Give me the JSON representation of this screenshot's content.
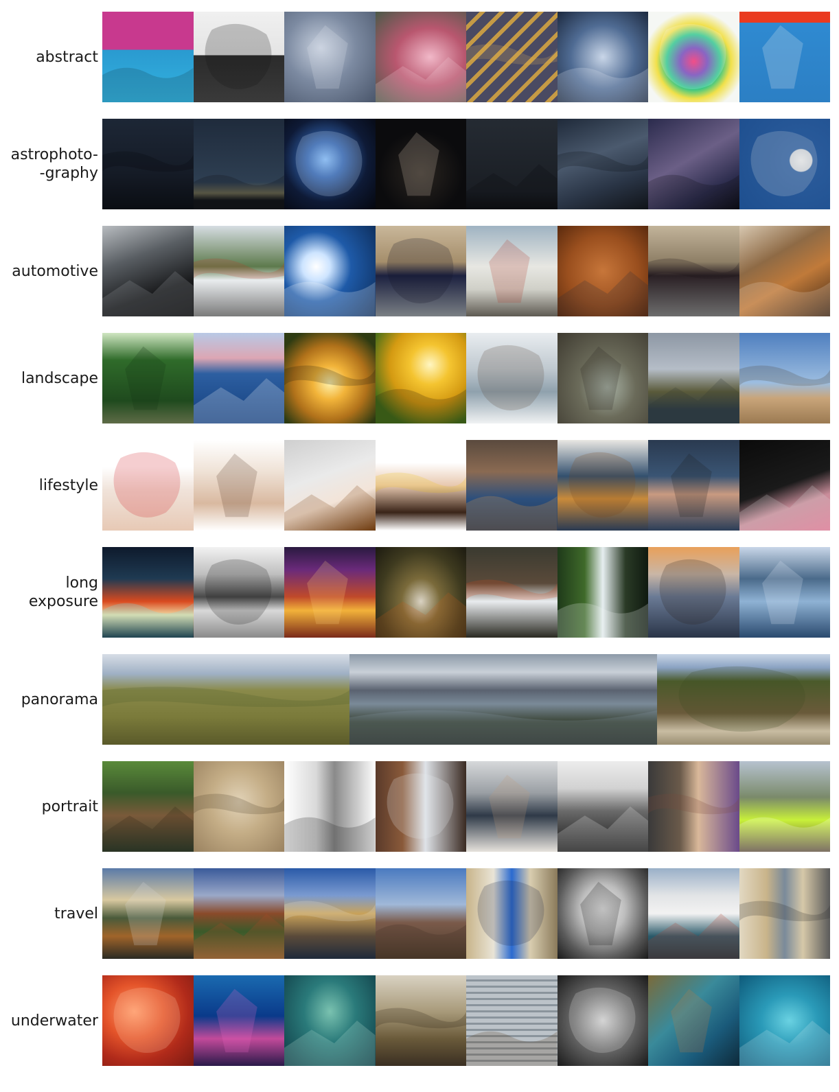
{
  "rows": [
    {
      "label": "abstract",
      "tiles": [
        {
          "name": "pink-blue-windows-photo",
          "bg": "linear-gradient(180deg,#c8398e 0%,#c8398e 42%,#2a9ad0 42%,#33b3e0 100%)",
          "accent": "#173a4a"
        },
        {
          "name": "steel-truss-photo",
          "bg": "linear-gradient(180deg,#f0f0f0 0%,#e4e4e4 48%,#2b2b2b 48%,#3a3a3a 100%)",
          "accent": "#111111"
        },
        {
          "name": "grey-curves-photo",
          "bg": "radial-gradient(ellipse at 40% 40%,#c7d0de 0%,#7c8aa1 45%,#4a566b 100%)",
          "accent": "#dfe4ee"
        },
        {
          "name": "pink-petals-photo",
          "bg": "radial-gradient(ellipse at 60% 50%,#f1b8c8 0%,#b9576f 45%,#4b5a48 100%)",
          "accent": "#f6d6de"
        },
        {
          "name": "diagonal-stripes-photo",
          "bg": "repeating-linear-gradient(135deg,#4a4a62 0px,#4a4a62 14px,#c59a45 14px,#c59a45 20px)",
          "accent": "#e0b25a"
        },
        {
          "name": "water-reflection-photo",
          "bg": "radial-gradient(ellipse at 50% 50%,#c9d6e8 0%,#4f6b93 50%,#1d2a40 100%)",
          "accent": "#e8eef7"
        },
        {
          "name": "color-blur-photo",
          "bg": "radial-gradient(circle at 50% 55%,#f0206a 0%,#6b3db5 20%,#27c48a 40%,#f1e04a 55%,#f5f7f4 75%)",
          "accent": "#f5f7f4"
        },
        {
          "name": "blue-facade-photo",
          "bg": "linear-gradient(180deg,#ea3a1f 0%,#ea3a1f 12%,#2f8ad1 12%,#2c7fc4 100%)",
          "accent": "#f2f2f2"
        }
      ]
    },
    {
      "label": "astrophoto-\n-graphy",
      "tiles": [
        {
          "name": "night-trees-photo",
          "bg": "linear-gradient(180deg,#1d2736 0%,#151b26 60%,#0a0d12 100%)",
          "accent": "#050608"
        },
        {
          "name": "horizon-stars-photo",
          "bg": "linear-gradient(180deg,#1f2b3c 0%,#2e3f52 70%,#6b6a52 82%,#111418 90%)",
          "accent": "#0c0f13"
        },
        {
          "name": "pleiades-photo",
          "bg": "radial-gradient(circle at 45% 45%,#7fb4ee 0%,#2f5fa8 25%,#0e1a36 60%,#05070e 100%)",
          "accent": "#cfe3ff"
        },
        {
          "name": "galaxies-photo",
          "bg": "radial-gradient(circle at 50% 60%,#2a2520 0%,#0b0b0d 60%)",
          "accent": "#d9c9b5"
        },
        {
          "name": "dark-sky-photo",
          "bg": "linear-gradient(180deg,#252b33 0%,#1a1e24 80%,#0d0f12 100%)",
          "accent": "#0a0b0d"
        },
        {
          "name": "milky-way-photo",
          "bg": "linear-gradient(160deg,#1f2a3a 0%,#4b5a6e 40%,#2a3546 70%,#101318 100%)",
          "accent": "#0b0d10"
        },
        {
          "name": "milky-way-purple-photo",
          "bg": "linear-gradient(150deg,#2b2b4d 0%,#6b5f86 45%,#2e2e4f 75%,#0d0d14 100%)",
          "accent": "#08080c"
        },
        {
          "name": "half-moon-photo",
          "bg": "radial-gradient(circle at 68% 46%,#e8e8e8 0%,#cfd3d8 14%,#2a5b9b 15%,#1e4f8f 100%)",
          "accent": "#d8dbe0"
        }
      ]
    },
    {
      "label": "automotive",
      "tiles": [
        {
          "name": "car-interior-photo",
          "bg": "linear-gradient(160deg,#b8bcc0 0%,#595e63 35%,#1a1b1d 70%,#0c0c0d 100%)",
          "accent": "#9ea3a8"
        },
        {
          "name": "white-hatchback-photo",
          "bg": "linear-gradient(180deg,#d6dde2 0%,#5d7a4c 45%,#e9ecee 60%,#7a7a7a 100%)",
          "accent": "#c0392b"
        },
        {
          "name": "blue-headlight-photo",
          "bg": "radial-gradient(circle at 35% 45%,#ffffff 0%,#cde4ff 18%,#1e5aa8 45%,#0c2a55 100%)",
          "accent": "#ffffff"
        },
        {
          "name": "convertible-photo",
          "bg": "linear-gradient(180deg,#c9b79a 0%,#a58e6b 40%,#1c2140 55%,#7a7f84 100%)",
          "accent": "#101226"
        },
        {
          "name": "white-fiat-photo",
          "bg": "linear-gradient(180deg,#9fb3c2 0%,#e7e7e2 45%,#d0d0c8 70%,#5e5a52 100%)",
          "accent": "#b03a2e"
        },
        {
          "name": "leather-emblem-photo",
          "bg": "radial-gradient(circle at 50% 50%,#c7763a 0%,#9a4f1e 55%,#5a2a0e 100%)",
          "accent": "#2a2f3a"
        },
        {
          "name": "dark-sedan-photo",
          "bg": "linear-gradient(180deg,#c2b49a 0%,#8e7f66 40%,#2a2024 55%,#6d6d6d 100%)",
          "accent": "#1a1416"
        },
        {
          "name": "leather-seats-photo",
          "bg": "linear-gradient(150deg,#d7c7b0 0%,#8e6a45 35%,#c07a3a 60%,#3a2414 100%)",
          "accent": "#e7dccb"
        }
      ]
    },
    {
      "label": "landscape",
      "tiles": [
        {
          "name": "forest-path-photo",
          "bg": "linear-gradient(180deg,#cfe6c1 0%,#2f6b2a 30%,#1f4a1e 75%,#5f6b47 100%)",
          "accent": "#143013"
        },
        {
          "name": "sailboat-sea-photo",
          "bg": "linear-gradient(180deg,#b8c9e6 0%,#dca6b3 28%,#2d5fa1 45%,#143f7e 100%)",
          "accent": "#ffffff"
        },
        {
          "name": "sunset-tree-photo",
          "bg": "radial-gradient(circle at 50% 55%,#fff3b0 0%,#f2b43a 25%,#b0711a 55%,#2e3b12 85%)",
          "accent": "#1d1a0c"
        },
        {
          "name": "golden-field-horse-photo",
          "bg": "radial-gradient(circle at 60% 35%,#fff6c2 0%,#f4c430 25%,#d49a12 50%,#3d6b1a 80%)",
          "accent": "#2a1c0a"
        },
        {
          "name": "snowy-river-photo",
          "bg": "linear-gradient(180deg,#e9edf0 0%,#bfc8cf 40%,#8fa1ad 65%,#f0f2f3 100%)",
          "accent": "#5b4a3a"
        },
        {
          "name": "stone-bridge-photo",
          "bg": "radial-gradient(ellipse at 55% 60%,#a9b3a6 0%,#6b6b5a 40%,#3e3a30 100%)",
          "accent": "#2a2620"
        },
        {
          "name": "cloudy-hills-photo",
          "bg": "linear-gradient(180deg,#8d97a4 0%,#b5bdc7 40%,#5a5a3a 65%,#2c3a44 85%)",
          "accent": "#2e3830"
        },
        {
          "name": "bare-tree-photo",
          "bg": "linear-gradient(180deg,#4f7fbf 0%,#9cbde0 55%,#c9a57a 72%,#9b7a52 100%)",
          "accent": "#4a3a2a"
        }
      ]
    },
    {
      "label": "lifestyle",
      "tiles": [
        {
          "name": "drinking-water-photo",
          "bg": "linear-gradient(180deg,#ffffff 0%,#ffffff 30%,#f0e3da 55%,#e7c9b5 100%)",
          "accent": "#d21f2a"
        },
        {
          "name": "eyebrow-care-photo",
          "bg": "linear-gradient(180deg,#ffffff 0%,#efe2d6 35%,#d9b9a0 70%,#ffffff 100%)",
          "accent": "#5a3a2a"
        },
        {
          "name": "dropper-bottle-photo",
          "bg": "linear-gradient(160deg,#cfcfcf 0%,#eaeaea 40%,#f3e4d8 65%,#6b3a10 100%)",
          "accent": "#7a3f0c"
        },
        {
          "name": "birthday-cake-photo",
          "bg": "linear-gradient(180deg,#ffffff 0%,#ffffff 25%,#e8c9b0 50%,#3a2418 80%,#ffffff 100%)",
          "accent": "#f0c419"
        },
        {
          "name": "child-eating-photo",
          "bg": "linear-gradient(180deg,#5a4a3e 0%,#8a6a52 35%,#2c4f7c 65%,#1f3556 100%)",
          "accent": "#f0a040"
        },
        {
          "name": "guitar-photo",
          "bg": "linear-gradient(180deg,#e9e7e3 0%,#33506e 40%,#c98a3a 65%,#2a3a52 100%)",
          "accent": "#7a4a1a"
        },
        {
          "name": "phone-hands-photo",
          "bg": "linear-gradient(180deg,#2a3a50 0%,#3a5574 40%,#c99a80 60%,#2b3e58 100%)",
          "accent": "#1a1a1a"
        },
        {
          "name": "phone-pink-photo",
          "bg": "linear-gradient(160deg,#0b0b0b 0%,#1a1a1a 50%,#c98d9a 70%,#e27a96 100%)",
          "accent": "#d9d9d9"
        }
      ]
    },
    {
      "label": "long\nexposure",
      "tiles": [
        {
          "name": "city-light-trails-photo",
          "bg": "linear-gradient(180deg,#0e1a2c 0%,#1f3a52 35%,#d94a1f 60%,#f0d7a0 75%,#0b1420 100%)",
          "accent": "#6bf2ff"
        },
        {
          "name": "bw-street-photo",
          "bg": "linear-gradient(180deg,#f2f2f2 0%,#bfbfbf 30%,#4a4a4a 55%,#d9d9d9 70%,#8a8a8a 100%)",
          "accent": "#1a1a1a"
        },
        {
          "name": "night-traffic-photo",
          "bg": "linear-gradient(180deg,#2a1a40 0%,#6a2a7a 25%,#c04a2a 55%,#f2b23a 70%,#7a2a1a 100%)",
          "accent": "#ffd27a"
        },
        {
          "name": "forest-stream-photo",
          "bg": "radial-gradient(ellipse at 50% 60%,#d9d2c2 0%,#7a6a3a 30%,#3e3a1f 65%,#1c1a10 100%)",
          "accent": "#c05a1a"
        },
        {
          "name": "autumn-cascade-photo",
          "bg": "linear-gradient(180deg,#3a3a30 0%,#5a4a3a 40%,#e9ecef 60%,#2a2a22 100%)",
          "accent": "#d04a1a"
        },
        {
          "name": "waterfall-photo",
          "bg": "linear-gradient(90deg,#1f3a1a 0%,#3f6a2a 30%,#e6eef0 50%,#2a3a26 75%,#0f1a10 100%)",
          "accent": "#f2f6f8"
        },
        {
          "name": "sunset-rocks-photo",
          "bg": "linear-gradient(180deg,#e9a05a 0%,#c9b6a6 30%,#6a7a95 55%,#2a3548 100%)",
          "accent": "#2a1f1a"
        },
        {
          "name": "mountain-river-photo",
          "bg": "linear-gradient(180deg,#c8d6e8 0%,#4a6a8a 35%,#8fb2d4 60%,#2a4a6e 100%)",
          "accent": "#dfeaf5"
        }
      ]
    },
    {
      "label": "panorama",
      "pano": true,
      "tiles": [
        {
          "name": "grassland-panorama-photo",
          "flex": 360,
          "bg": "linear-gradient(180deg,#d7dde6 0%,#9fb0c4 22%,#8a8a4a 40%,#7a7a3a 70%,#5a5a2a 100%)",
          "accent": "#4a5a2a"
        },
        {
          "name": "lake-valley-panorama-photo",
          "flex": 448,
          "bg": "linear-gradient(180deg,#8d9aa8 0%,#c9d0d8 20%,#5a6270 40%,#7a8a98 55%,#3a4436 75%,#2a2f28 100%)",
          "accent": "#8fa0b0"
        },
        {
          "name": "hillside-panorama-photo",
          "flex": 252,
          "bg": "linear-gradient(180deg,#c9d6e6 0%,#8aa2c2 15%,#4a5a2a 30%,#6a5a3a 65%,#c8bca2 85%,#9a8e72 100%)",
          "accent": "#3a4a22"
        }
      ]
    },
    {
      "label": "portrait",
      "tiles": [
        {
          "name": "man-hat-forest-photo",
          "bg": "linear-gradient(180deg,#5a8a3a 0%,#3a5a2a 35%,#7a5a3a 60%,#2a3a2a 100%)",
          "accent": "#2a1f14"
        },
        {
          "name": "sepia-portrait-photo",
          "bg": "radial-gradient(ellipse at 50% 45%,#e2d3b8 0%,#c4ad86 45%,#9a8260 100%)",
          "accent": "#4a3a26"
        },
        {
          "name": "bw-woman-smiling-photo",
          "bg": "linear-gradient(90deg,#ffffff 0%,#d9d9d9 35%,#8a8a8a 55%,#ffffff 100%)",
          "accent": "#1a1a1a"
        },
        {
          "name": "lab-worker-photo",
          "bg": "linear-gradient(90deg,#5a3a2a 0%,#8a5a3a 30%,#dfe3e8 55%,#3a2a22 100%)",
          "accent": "#e8ecf0"
        },
        {
          "name": "woman-hoodie-photo",
          "bg": "linear-gradient(180deg,#d6d8da 0%,#9a9fa4 35%,#2f3a48 60%,#e6e2dc 100%)",
          "accent": "#c09a7a"
        },
        {
          "name": "naval-officer-photo",
          "bg": "linear-gradient(180deg,#ececec 0%,#d2d2d2 30%,#6a6a6a 55%,#151515 100%)",
          "accent": "#f2f2f2"
        },
        {
          "name": "painted-portrait-photo",
          "bg": "linear-gradient(90deg,#3a3a3a 0%,#6a5a4a 35%,#d9b89a 55%,#6a4a8a 100%)",
          "accent": "#7a4a3a"
        },
        {
          "name": "construction-worker-photo",
          "bg": "linear-gradient(180deg,#b6c2cf 0%,#7a8a6a 40%,#c8f03a 65%,#5a4a3a 100%)",
          "accent": "#ffffff"
        }
      ]
    },
    {
      "label": "travel",
      "tiles": [
        {
          "name": "autumn-marsh-photo",
          "bg": "linear-gradient(180deg,#5a7aa8 0%,#d9c9a0 35%,#4a5a3a 55%,#a0642a 75%,#2a2a22 100%)",
          "accent": "#d9d9d9"
        },
        {
          "name": "canal-house-photo",
          "bg": "linear-gradient(180deg,#3a5a9a 0%,#9aa8c8 30%,#8a4a2a 50%,#3a5a2a 70%,#8a6a3a 100%)",
          "accent": "#b04a2a"
        },
        {
          "name": "riverside-cafe-photo",
          "bg": "linear-gradient(180deg,#2a5aa8 0%,#7a9ad0 30%,#c9a25a 50%,#5a4a3a 75%,#1f2a3a 100%)",
          "accent": "#e8e2d6"
        },
        {
          "name": "bare-forest-photo",
          "bg": "linear-gradient(180deg,#4a7ac0 0%,#a0b8d8 40%,#7a5a4a 60%,#4a3a2a 100%)",
          "accent": "#3a2a1f"
        },
        {
          "name": "narrow-street-photo",
          "bg": "linear-gradient(90deg,#c8b48a 0%,#e9e4d6 30%,#2a6ad0 50%,#d9cdb0 70%,#8a7a5a 100%)",
          "accent": "#1f2a4a"
        },
        {
          "name": "subway-tunnel-photo",
          "bg": "radial-gradient(ellipse at 50% 45%,#f2f2f2 0%,#bdbdbd 35%,#5a5a5a 70%,#1a1a1a 100%)",
          "accent": "#111111"
        },
        {
          "name": "harbor-boat-photo",
          "bg": "linear-gradient(180deg,#9ab0c8 0%,#e2e4e6 30%,#f2f2f2 50%,#2a5a6a 75%,#1a3a44 100%)",
          "accent": "#b03a2a"
        },
        {
          "name": "old-town-street-photo",
          "bg": "linear-gradient(90deg,#e2d8c2 0%,#c9b48a 30%,#7a8a9a 50%,#d6c8a8 70%,#5a5a5a 100%)",
          "accent": "#2a2a2a"
        }
      ]
    },
    {
      "label": "underwater",
      "tiles": [
        {
          "name": "red-fish-photo",
          "bg": "radial-gradient(ellipse at 35% 40%,#ff9a6a 0%,#e4542a 35%,#b02a1a 65%,#7a1a12 100%)",
          "accent": "#ffd0b0"
        },
        {
          "name": "coral-diver-photo",
          "bg": "linear-gradient(180deg,#1a6ab0 0%,#0a3a8a 45%,#c24a9a 70%,#2a1a4a 100%)",
          "accent": "#f06ac8"
        },
        {
          "name": "diver-greenwater-photo",
          "bg": "radial-gradient(ellipse at 50% 40%,#7ac2b0 0%,#2a7a7a 40%,#0e3a44 100%)",
          "accent": "#c2e6da"
        },
        {
          "name": "riverbed-branch-photo",
          "bg": "linear-gradient(180deg,#d9d2c2 0%,#a89a7a 40%,#6a5a3a 70%,#3a2f22 100%)",
          "accent": "#2a1f14"
        },
        {
          "name": "diving-bird-photo",
          "bg": "repeating-linear-gradient(180deg,#bcc3c9 0px,#bcc3c9 6px,#8a949c 6px,#8a949c 9px)",
          "accent": "#5a3a1a"
        },
        {
          "name": "bw-fish-school-photo",
          "bg": "radial-gradient(ellipse at 50% 50%,#cfcfcf 0%,#6a6a6a 45%,#1a1a1a 100%)",
          "accent": "#eaeaea"
        },
        {
          "name": "reef-teal-photo",
          "bg": "linear-gradient(135deg,#7a6a3a 0%,#3a8a9a 40%,#1a5a7a 70%,#0e2a3a 100%)",
          "accent": "#c97a3a"
        },
        {
          "name": "shark-photo",
          "bg": "radial-gradient(ellipse at 55% 50%,#6ad2e2 0%,#2a9ab8 40%,#0e5a7a 100%)",
          "accent": "#cfe8ee"
        }
      ]
    }
  ]
}
